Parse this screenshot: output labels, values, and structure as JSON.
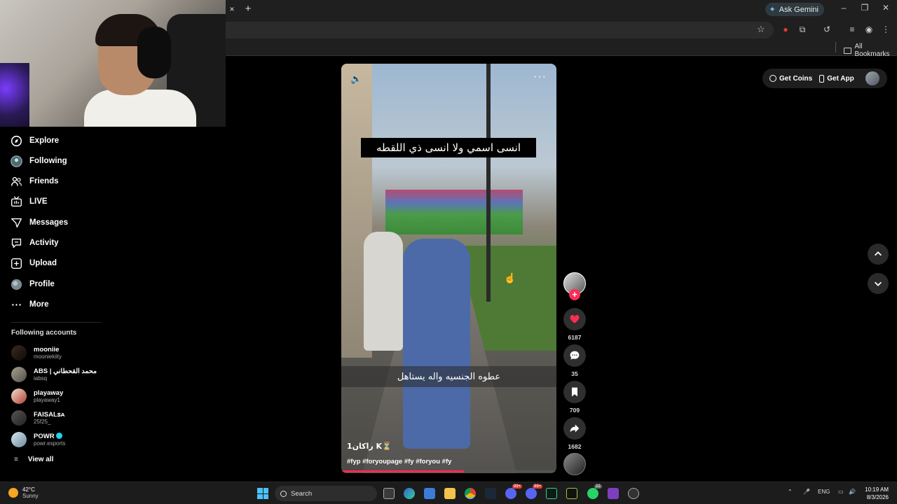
{
  "browser": {
    "tab_close": "×",
    "new_tab": "+",
    "ask_gemini": "Ask Gemini",
    "all_bookmarks": "All Bookmarks"
  },
  "nav": {
    "items": [
      {
        "label": "Explore",
        "icon": "compass-icon"
      },
      {
        "label": "Following",
        "icon": "following-avatar-icon"
      },
      {
        "label": "Friends",
        "icon": "friends-icon"
      },
      {
        "label": "LIVE",
        "icon": "live-icon"
      },
      {
        "label": "Messages",
        "icon": "messages-icon"
      },
      {
        "label": "Activity",
        "icon": "activity-icon"
      },
      {
        "label": "Upload",
        "icon": "upload-icon"
      },
      {
        "label": "Profile",
        "icon": "profile-avatar-icon"
      },
      {
        "label": "More",
        "icon": "more-icon"
      }
    ]
  },
  "following_accounts": {
    "heading": "Following accounts",
    "accounts": [
      {
        "name": "mooniie",
        "handle": "mooniekiity"
      },
      {
        "name": "ABS | محمد القحطاني",
        "handle": "iabsq"
      },
      {
        "name": "playaway",
        "handle": "playaway1"
      },
      {
        "name": "FAISALꜱᴀ",
        "handle": "25f25_"
      },
      {
        "name": "POWR",
        "handle": "powr.esports",
        "verified": true
      }
    ],
    "view_all": "View all"
  },
  "video": {
    "caption_top": "انسى اسمي ولا انسى ذي اللقطه",
    "caption_mid": "عطوه الجنسيه واله يستاهل",
    "author": "1راكان K⏳",
    "hashtags": "#fyp #foryoupage #fy #foryou #fy",
    "progress": 0.57
  },
  "actions": {
    "likes": "6187",
    "comments": "35",
    "bookmarks": "709",
    "shares": "1682"
  },
  "topright": {
    "get_coins": "Get Coins",
    "get_app": "Get App"
  },
  "taskbar": {
    "temp": "42°C",
    "condition": "Sunny",
    "search": "Search",
    "lang": "ENG",
    "time": "10:19 AM",
    "date": "8/3/2026",
    "badge_1": "99+",
    "badge_2": "99+",
    "badge_3": "22"
  },
  "colors": {
    "accent": "#fe2c55",
    "background": "#000000",
    "chrome": "#1f1f1f"
  }
}
